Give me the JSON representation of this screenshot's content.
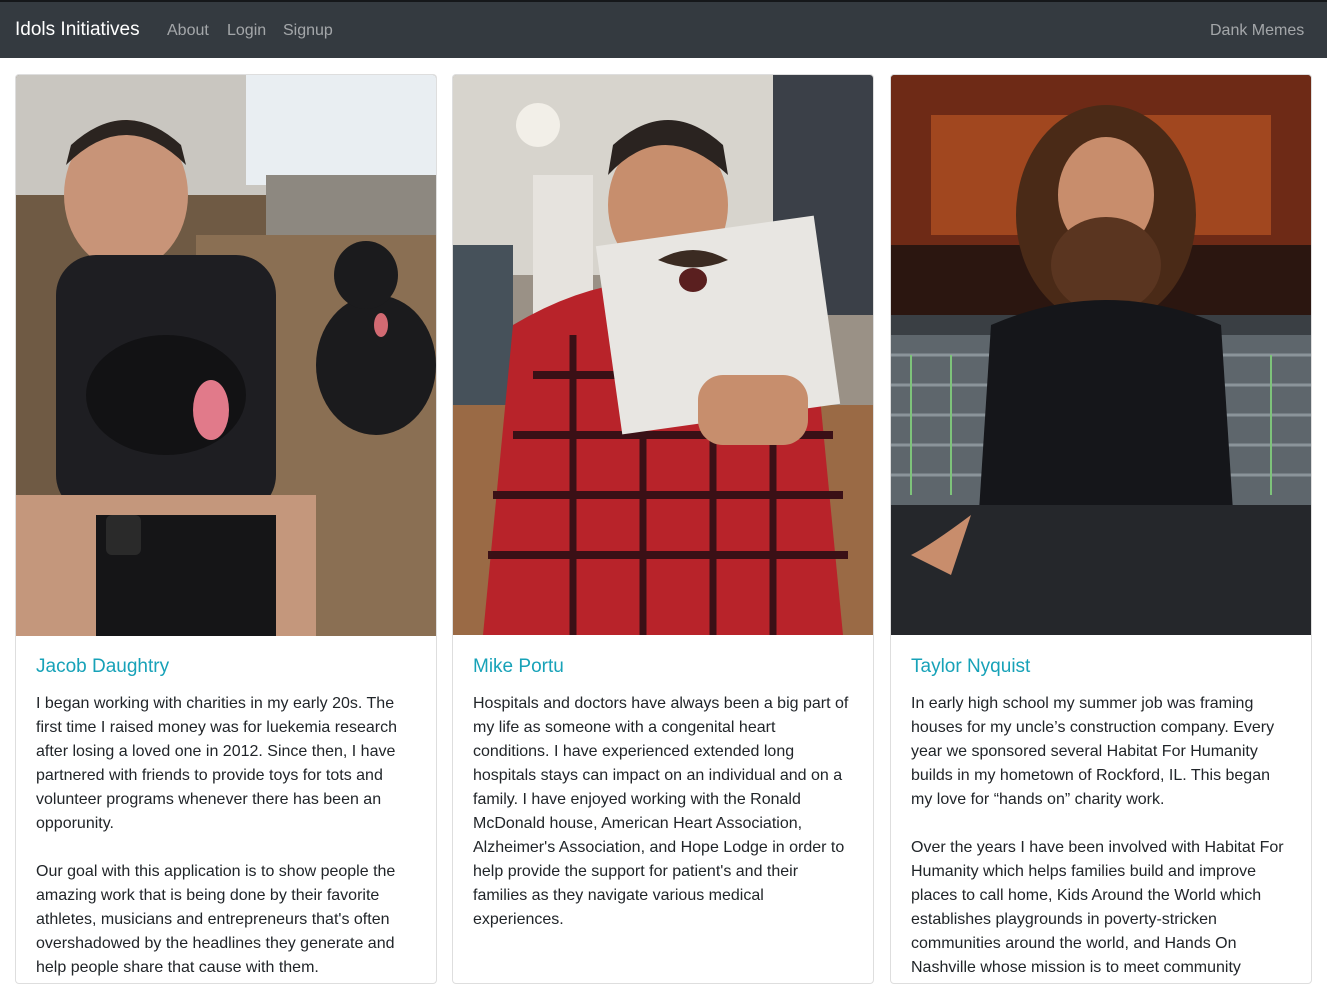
{
  "navbar": {
    "brand": "Idols Initiatives",
    "links": [
      "About",
      "Login",
      "Signup"
    ],
    "right_link": "Dank Memes"
  },
  "colors": {
    "navbar_bg": "#343a40",
    "title_accent": "#17a2b8",
    "body_text": "#212529"
  },
  "cards": [
    {
      "name": "Jacob Daughtry",
      "paragraphs": [
        "I began working with charities in my early 20s. The first time I raised money was for luekemia research after losing a loved one in 2012. Since then, I have partnered with friends to provide toys for tots and volunteer programs whenever there has been an opporunity.",
        "Our goal with this application is to show people the amazing work that is being done by their favorite athletes, musicians and entrepreneurs that's often overshadowed by the headlines they generate and help people share that cause with them."
      ]
    },
    {
      "name": "Mike Portu",
      "paragraphs": [
        "Hospitals and doctors have always been a big part of my life as someone with a congenital heart conditions. I have experienced extended long hospitals stays can impact on an individual and on a family. I have enjoyed working with the Ronald McDonald house, American Heart Association, Alzheimer's Association, and Hope Lodge in order to help provide the support for patient's and their families as they navigate various medical experiences."
      ]
    },
    {
      "name": "Taylor Nyquist",
      "paragraphs": [
        "In early high school my summer job was framing houses for my uncle’s construction company. Every year we sponsored several Habitat For Humanity builds in my hometown of Rockford, IL. This began my love for “hands on” charity work.",
        "Over the years I have been involved with Habitat For Humanity which helps families build and improve places to call home, Kids Around the World which establishes playgrounds in poverty-stricken communities around the world, and Hands On Nashville whose mission is to meet community needs."
      ]
    }
  ]
}
